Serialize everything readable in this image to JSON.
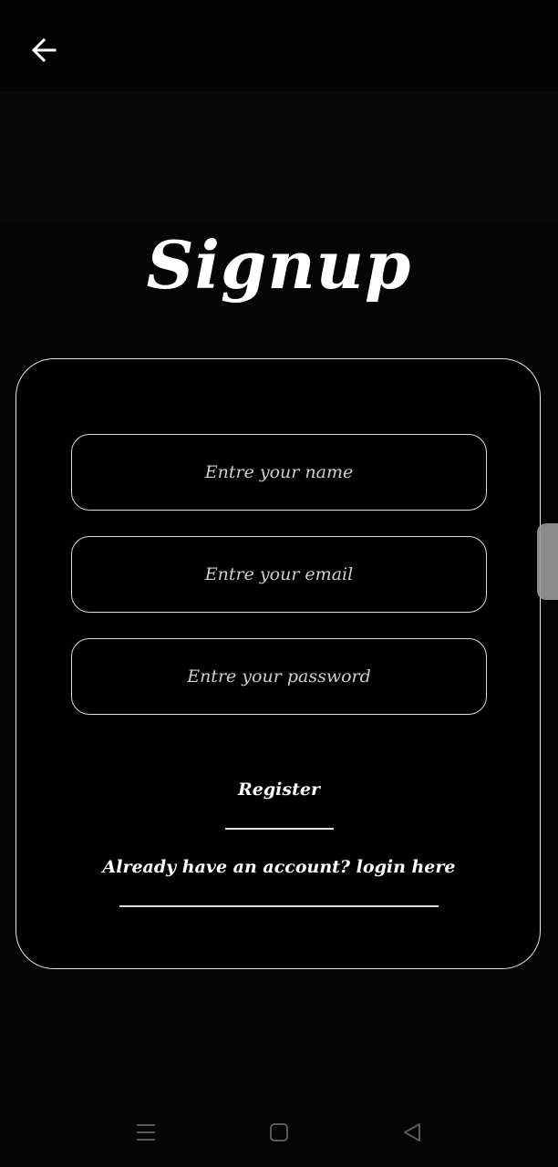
{
  "header": {
    "back_icon": "arrow-left-icon"
  },
  "page": {
    "title": "Signup"
  },
  "form": {
    "name_placeholder": "Entre your name",
    "email_placeholder": "Entre your email",
    "password_placeholder": "Entre your password",
    "name_value": "",
    "email_value": "",
    "password_value": ""
  },
  "actions": {
    "register_label": "Register",
    "login_link_label": "Already have an account?  login here"
  },
  "system_nav": {
    "menu_icon": "menu-lines-icon",
    "home_icon": "square-home-icon",
    "back_icon": "triangle-back-icon"
  },
  "colors": {
    "background": "#050505",
    "text": "#ffffff",
    "border": "#dcdcdc"
  }
}
